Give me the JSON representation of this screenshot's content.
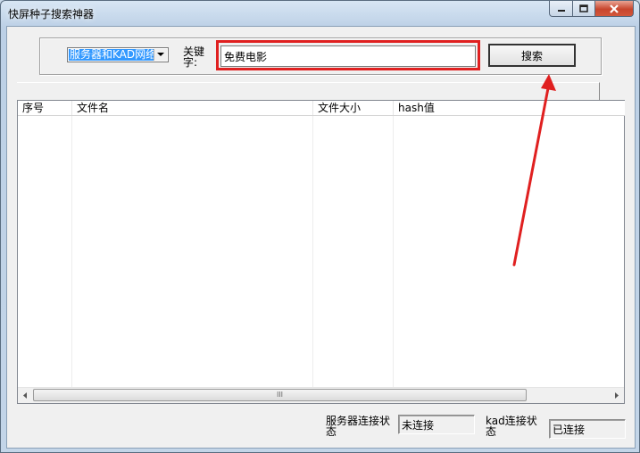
{
  "window": {
    "title": "快屏种子搜索神器"
  },
  "search": {
    "source_selected": "服务器和KAD网络",
    "keyword_label": "关键字:",
    "keyword_value": "免费电影",
    "search_button": "搜索"
  },
  "list": {
    "columns": [
      "序号",
      "文件名",
      "文件大小",
      "hash值"
    ],
    "rows": [],
    "scroll_grip": "III"
  },
  "status": {
    "server_label": "服务器连接状态",
    "server_value": "未连接",
    "kad_label": "kad连接状态",
    "kad_value": "已连接"
  },
  "colors": {
    "highlight_box": "#e02020",
    "selection": "#3399ff"
  },
  "icons": {
    "minimize": "minimize-icon",
    "maximize": "maximize-icon",
    "close": "close-icon",
    "dropdown": "chevron-down-icon",
    "annotation": "red-arrow-icon"
  }
}
